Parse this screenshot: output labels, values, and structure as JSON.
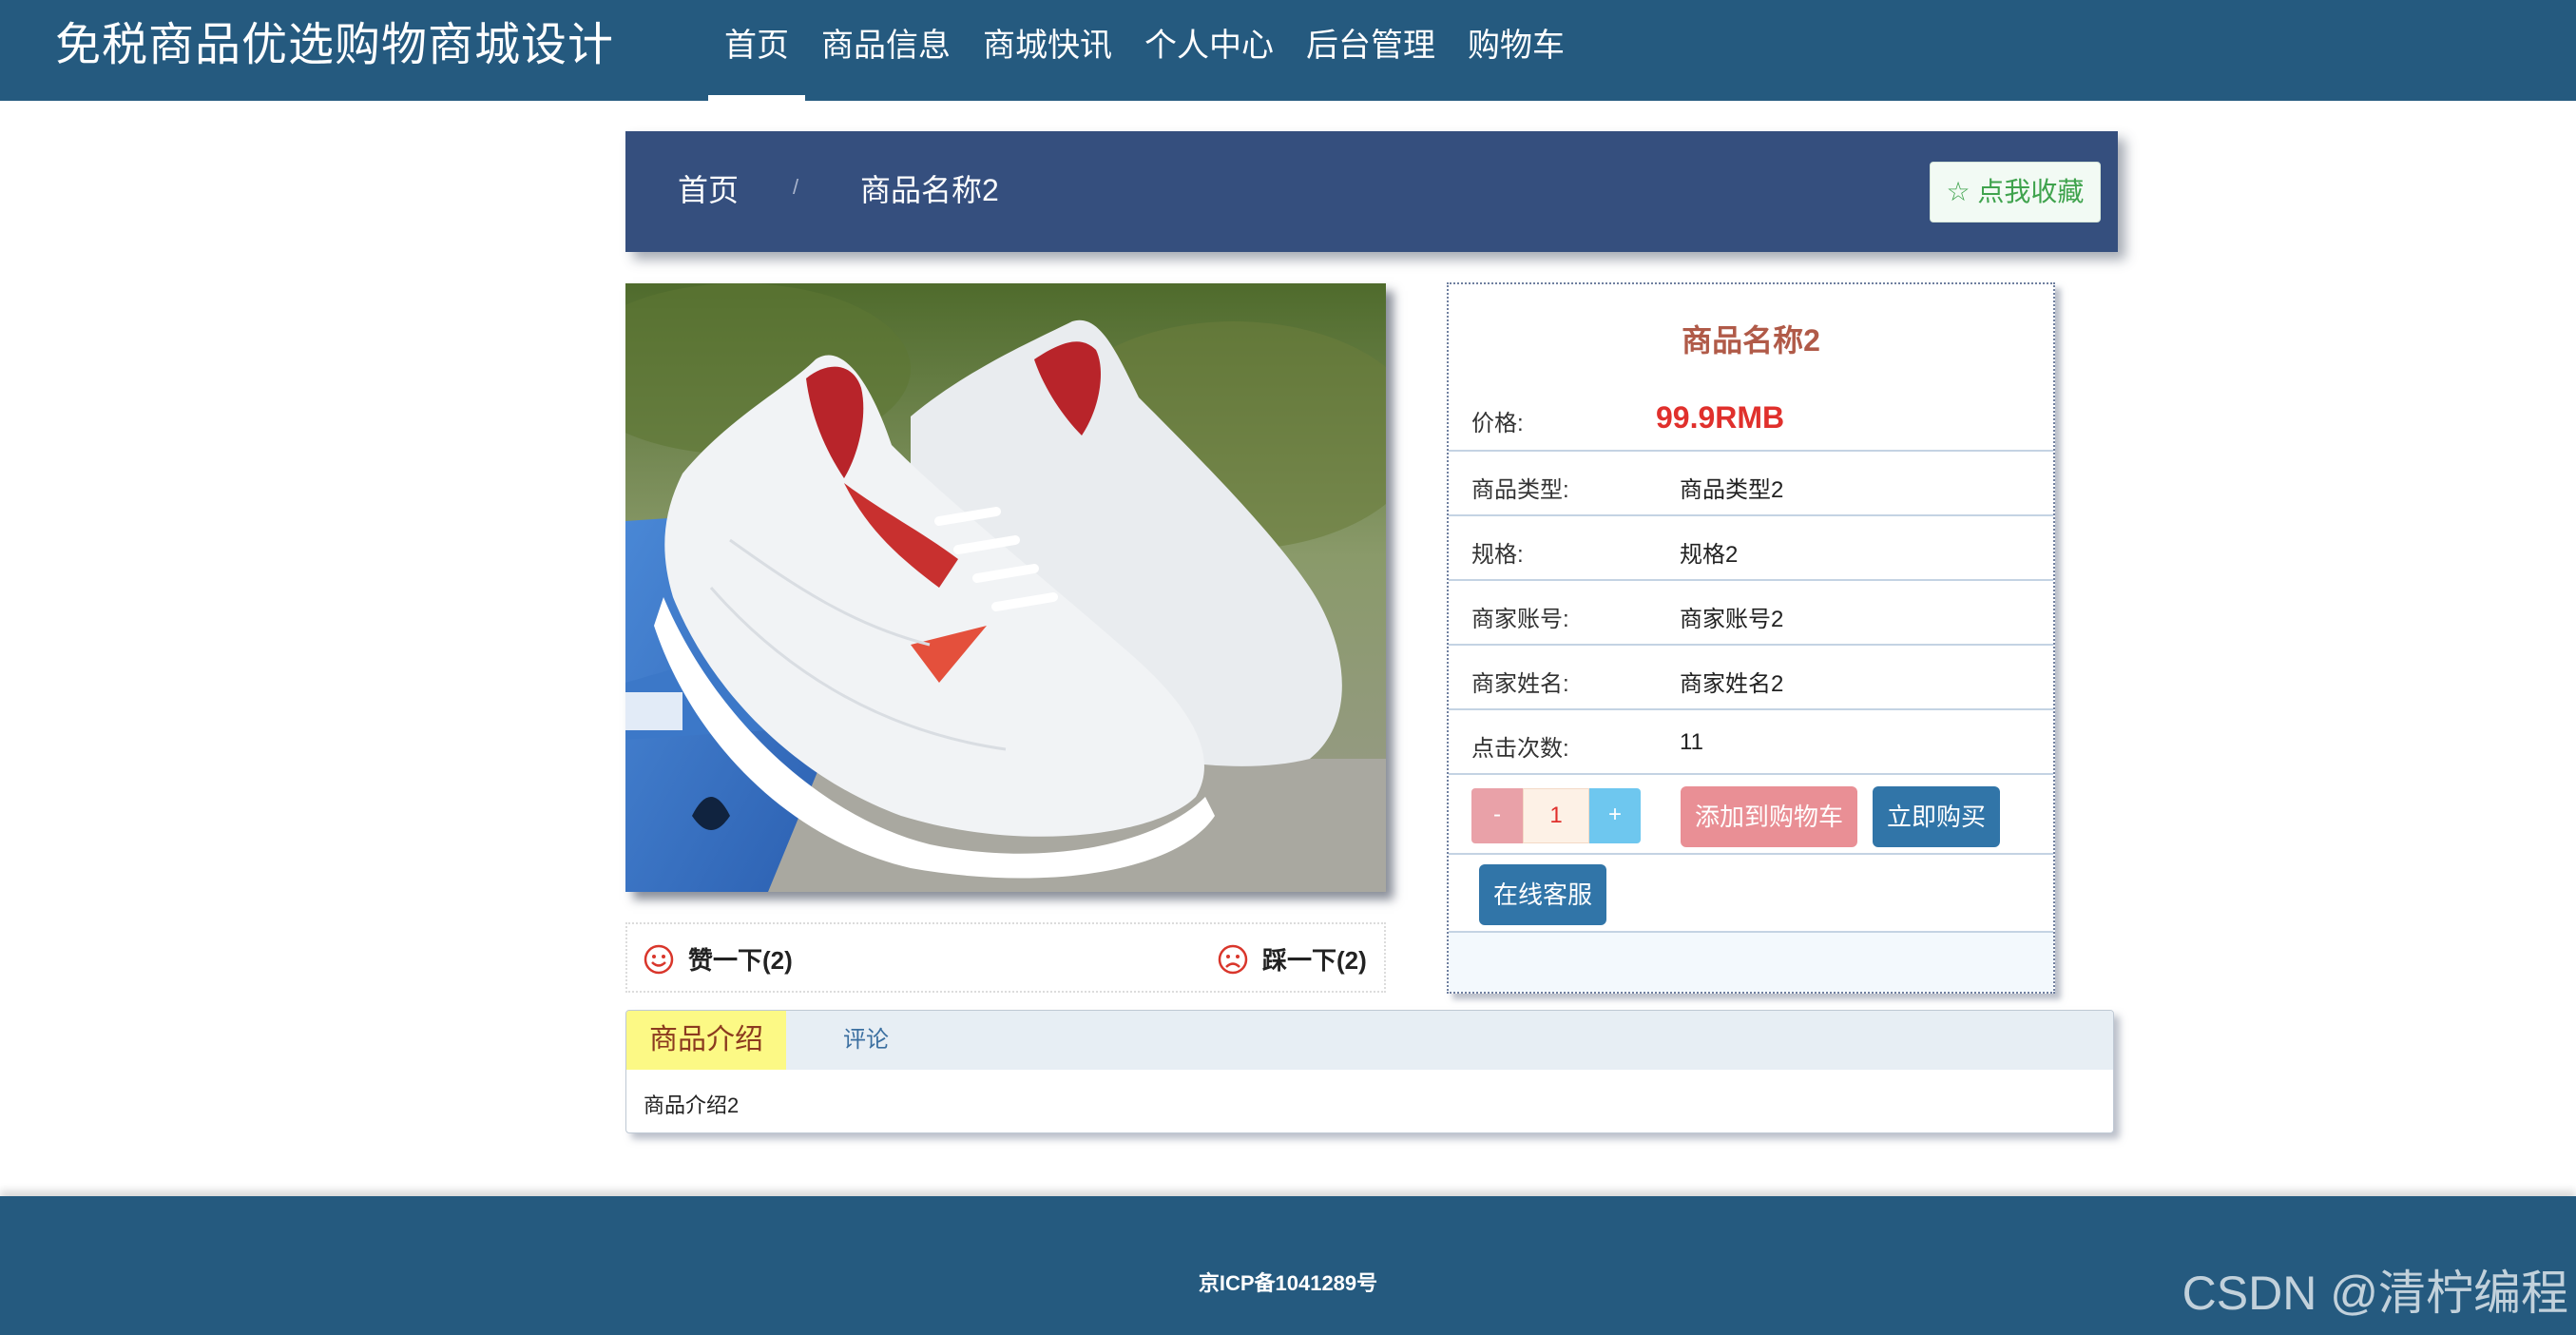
{
  "site": {
    "title": "免税商品优选购物商城设计"
  },
  "nav": {
    "items": [
      "首页",
      "商品信息",
      "商城快讯",
      "个人中心",
      "后台管理",
      "购物车"
    ],
    "active": "首页"
  },
  "breadcrumb": {
    "home": "首页",
    "separator": "/",
    "current": "商品名称2",
    "favorite_label": "☆ 点我收藏"
  },
  "reactions": {
    "like_label": "赞一下(2)",
    "dislike_label": "踩一下(2)"
  },
  "product": {
    "name": "商品名称2",
    "price_label": "价格:",
    "price": "99.9RMB",
    "fields": [
      {
        "label": "商品类型:",
        "value": "商品类型2"
      },
      {
        "label": "规格:",
        "value": "规格2"
      },
      {
        "label": "商家账号:",
        "value": "商家账号2"
      },
      {
        "label": "商家姓名:",
        "value": "商家姓名2"
      },
      {
        "label": "点击次数:",
        "value": "11"
      }
    ],
    "quantity": "1",
    "minus_label": "-",
    "plus_label": "+",
    "add_cart_label": "添加到购物车",
    "buy_now_label": "立即购买",
    "service_label": "在线客服"
  },
  "tabs": {
    "active_label": "商品介绍",
    "other_label": "评论",
    "content": "商品介绍2"
  },
  "footer": {
    "icp": "京ICP备1041289号",
    "watermark": "CSDN @清柠编程"
  },
  "colors": {
    "header": "#255a7f",
    "crumb_bar": "#354f7e",
    "price": "#e0302c",
    "title": "#b05a48",
    "accent_button": "#3175a8",
    "cart_button": "#e98f95"
  }
}
